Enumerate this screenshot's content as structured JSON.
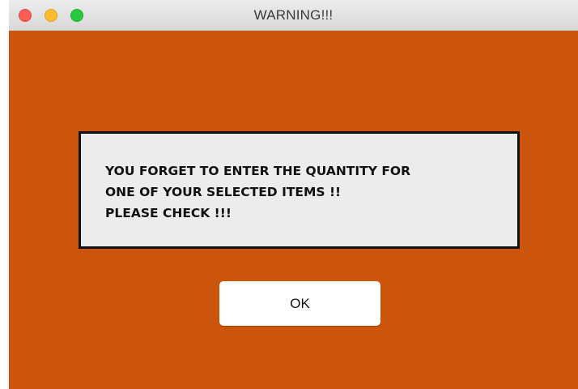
{
  "window": {
    "title": "WARNING!!!"
  },
  "titlebar": {
    "buttons": [
      "close",
      "minimize",
      "zoom"
    ]
  },
  "dialog": {
    "message_lines": [
      "YOU FORGET TO ENTER THE QUANTITY FOR",
      "ONE OF YOUR SELECTED ITEMS !!",
      "PLEASE CHECK !!!"
    ],
    "ok_label": "OK"
  },
  "colors": {
    "background": "#cc550c",
    "message_box": "#ececec",
    "button": "#ffffff",
    "close": "#fc5f57",
    "minimize": "#fdbc2e",
    "zoom": "#28c840"
  }
}
